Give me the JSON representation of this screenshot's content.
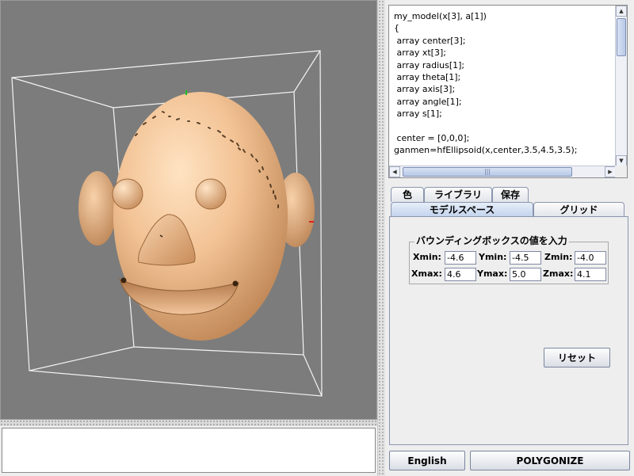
{
  "editor": {
    "lines": [
      "my_model(x[3], a[1])",
      "{",
      " array center[3];",
      " array xt[3];",
      " array radius[1];",
      " array theta[1];",
      " array axis[3];",
      " array angle[1];",
      " array s[1];",
      "",
      " center = [0,0,0];",
      "ganmen=hfEllipsoid(x,center,3.5,4.5,3.5);"
    ]
  },
  "tabs": {
    "row_top": [
      "色",
      "ライブラリ",
      "保存"
    ],
    "model_space": "モデルスペース",
    "grid": "グリッド"
  },
  "bounding_box": {
    "title": "バウンディングボックスの値を入力",
    "xmin_label": "Xmin:",
    "xmin": "-4.6",
    "ymin_label": "Ymin:",
    "ymin": "-4.5",
    "zmin_label": "Zmin:",
    "zmin": "-4.0",
    "xmax_label": "Xmax:",
    "xmax": "4.6",
    "ymax_label": "Ymax:",
    "ymax": "5.0",
    "zmax_label": "Zmax:",
    "zmax": "4.1"
  },
  "buttons": {
    "reset": "リセット",
    "english": "English",
    "polygonize": "POLYGONIZE"
  },
  "colors": {
    "viewport_bg": "#7c7c7c",
    "model_skin": "#f2c294",
    "selected_tab": "#c2d3ed"
  }
}
